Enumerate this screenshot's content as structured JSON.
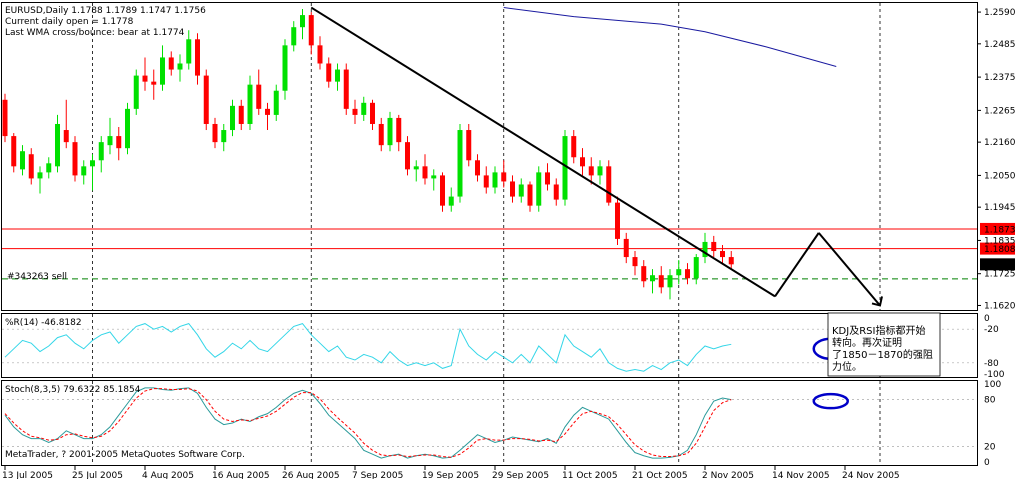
{
  "colors": {
    "background": "#ffffff",
    "bull": "#00e000",
    "bear": "#ff0000",
    "wma": "#1a1aa0",
    "trend": "#000000",
    "hline": "#ff0000",
    "sell_line": "#008000",
    "wpr": "#33d6e8",
    "stoch_main": "#2a9a9a",
    "stoch_signal": "#ff0000",
    "ellipse": "#0000c8"
  },
  "header": {
    "line1": "EURUSD,Daily  1.1788 1.1789 1.1747 1.1756",
    "line2": "Current daily open = 1.1778",
    "line3": "Last WMA cross/bounce: bear at 1.1774"
  },
  "order_label": "#343263 sell",
  "wpr_label": "%R(14) -46.8182",
  "stoch_label": "Stoch(8,3,5) 79.6322 85.1854",
  "copyright": "MetaTrader, ? 2001-2005 MetaQuotes Software Corp.",
  "annotation": [
    "KDJ及RSI指标都开始",
    "转向。再次证明",
    "了1850－1870的强阻",
    "力位。"
  ],
  "chart_data": {
    "type": "candlestick",
    "symbol": "EURUSD",
    "timeframe": "Daily",
    "price_ticks": [
      "1.2590",
      "1.2485",
      "1.2375",
      "1.2265",
      "1.2160",
      "1.2050",
      "1.1945",
      "1.1835",
      "1.1725",
      "1.1620"
    ],
    "price_range": [
      1.1605,
      1.262
    ],
    "x_labels": [
      "13 Jul 2005",
      "25 Jul 2005",
      "4 Aug 2005",
      "16 Aug 2005",
      "26 Aug 2005",
      "7 Sep 2005",
      "19 Sep 2005",
      "29 Sep 2005",
      "11 Oct 2005",
      "21 Oct 2005",
      "2 Nov 2005",
      "14 Nov 2005",
      "24 Nov 2005"
    ],
    "x_label_bars": [
      0,
      8,
      16,
      24,
      32,
      40,
      48,
      56,
      64,
      72,
      80,
      88,
      96
    ],
    "period_separator_bars": [
      10,
      35,
      57,
      77
    ],
    "future_separator_bar": 100,
    "price_levels": [
      {
        "value": 1.1873,
        "label": "1.1873",
        "style": "solid"
      },
      {
        "value": 1.1808,
        "label": "1.1808",
        "style": "solid"
      },
      {
        "value": 1.1756,
        "label": "1.1756",
        "style": "current"
      },
      {
        "value": 1.1708,
        "label": "",
        "style": "dashed"
      }
    ],
    "trend_lines": [
      {
        "from": [
          35,
          1.2605
        ],
        "to": [
          88,
          1.165
        ]
      },
      {
        "from": [
          88,
          1.165
        ],
        "to": [
          93,
          1.186
        ]
      },
      {
        "from": [
          93,
          1.186
        ],
        "to": [
          100,
          1.162
        ]
      }
    ],
    "wma": [
      {
        "bar": 57,
        "price": 1.2605
      },
      {
        "bar": 65,
        "price": 1.2575
      },
      {
        "bar": 75,
        "price": 1.255
      },
      {
        "bar": 80,
        "price": 1.2525
      },
      {
        "bar": 87,
        "price": 1.2475
      },
      {
        "bar": 95,
        "price": 1.241
      }
    ],
    "candles": [
      [
        1.23,
        1.232,
        1.216,
        1.218
      ],
      [
        1.218,
        1.219,
        1.206,
        1.208
      ],
      [
        1.207,
        1.215,
        1.205,
        1.213
      ],
      [
        1.212,
        1.214,
        1.202,
        1.204
      ],
      [
        1.204,
        1.208,
        1.199,
        1.206
      ],
      [
        1.206,
        1.211,
        1.204,
        1.209
      ],
      [
        1.208,
        1.225,
        1.206,
        1.222
      ],
      [
        1.22,
        1.23,
        1.214,
        1.216
      ],
      [
        1.216,
        1.218,
        1.203,
        1.205
      ],
      [
        1.205,
        1.21,
        1.202,
        1.208
      ],
      [
        1.208,
        1.212,
        1.2,
        1.21
      ],
      [
        1.21,
        1.218,
        1.206,
        1.216
      ],
      [
        1.215,
        1.224,
        1.212,
        1.218
      ],
      [
        1.218,
        1.221,
        1.21,
        1.214
      ],
      [
        1.214,
        1.229,
        1.212,
        1.227
      ],
      [
        1.227,
        1.24,
        1.225,
        1.238
      ],
      [
        1.238,
        1.244,
        1.233,
        1.236
      ],
      [
        1.236,
        1.24,
        1.23,
        1.235
      ],
      [
        1.235,
        1.248,
        1.233,
        1.244
      ],
      [
        1.244,
        1.246,
        1.238,
        1.24
      ],
      [
        1.24,
        1.245,
        1.236,
        1.242
      ],
      [
        1.242,
        1.253,
        1.24,
        1.25
      ],
      [
        1.25,
        1.252,
        1.235,
        1.238
      ],
      [
        1.238,
        1.24,
        1.22,
        1.222
      ],
      [
        1.222,
        1.224,
        1.214,
        1.216
      ],
      [
        1.216,
        1.222,
        1.213,
        1.22
      ],
      [
        1.22,
        1.23,
        1.218,
        1.228
      ],
      [
        1.228,
        1.23,
        1.22,
        1.222
      ],
      [
        1.222,
        1.238,
        1.22,
        1.235
      ],
      [
        1.235,
        1.24,
        1.225,
        1.227
      ],
      [
        1.227,
        1.229,
        1.22,
        1.225
      ],
      [
        1.225,
        1.235,
        1.223,
        1.233
      ],
      [
        1.233,
        1.25,
        1.23,
        1.248
      ],
      [
        1.248,
        1.256,
        1.246,
        1.254
      ],
      [
        1.254,
        1.26,
        1.25,
        1.258
      ],
      [
        1.258,
        1.259,
        1.245,
        1.248
      ],
      [
        1.248,
        1.251,
        1.24,
        1.242
      ],
      [
        1.242,
        1.244,
        1.234,
        1.236
      ],
      [
        1.236,
        1.242,
        1.233,
        1.24
      ],
      [
        1.24,
        1.242,
        1.225,
        1.227
      ],
      [
        1.227,
        1.23,
        1.222,
        1.225
      ],
      [
        1.225,
        1.231,
        1.223,
        1.229
      ],
      [
        1.229,
        1.23,
        1.22,
        1.222
      ],
      [
        1.222,
        1.224,
        1.213,
        1.215
      ],
      [
        1.215,
        1.226,
        1.213,
        1.224
      ],
      [
        1.224,
        1.225,
        1.213,
        1.216
      ],
      [
        1.216,
        1.218,
        1.205,
        1.207
      ],
      [
        1.207,
        1.21,
        1.203,
        1.208
      ],
      [
        1.208,
        1.212,
        1.202,
        1.204
      ],
      [
        1.204,
        1.207,
        1.2,
        1.205
      ],
      [
        1.205,
        1.206,
        1.193,
        1.195
      ],
      [
        1.195,
        1.201,
        1.193,
        1.198
      ],
      [
        1.198,
        1.222,
        1.196,
        1.22
      ],
      [
        1.22,
        1.222,
        1.208,
        1.21
      ],
      [
        1.21,
        1.212,
        1.203,
        1.205
      ],
      [
        1.205,
        1.208,
        1.199,
        1.201
      ],
      [
        1.201,
        1.208,
        1.199,
        1.206
      ],
      [
        1.206,
        1.21,
        1.201,
        1.203
      ],
      [
        1.203,
        1.205,
        1.196,
        1.198
      ],
      [
        1.198,
        1.204,
        1.196,
        1.202
      ],
      [
        1.202,
        1.203,
        1.193,
        1.195
      ],
      [
        1.195,
        1.208,
        1.193,
        1.206
      ],
      [
        1.206,
        1.209,
        1.2,
        1.202
      ],
      [
        1.202,
        1.204,
        1.195,
        1.197
      ],
      [
        1.197,
        1.22,
        1.195,
        1.218
      ],
      [
        1.218,
        1.22,
        1.209,
        1.211
      ],
      [
        1.211,
        1.214,
        1.205,
        1.208
      ],
      [
        1.208,
        1.211,
        1.202,
        1.205
      ],
      [
        1.205,
        1.21,
        1.202,
        1.208
      ],
      [
        1.208,
        1.21,
        1.195,
        1.196
      ],
      [
        1.196,
        1.198,
        1.182,
        1.184
      ],
      [
        1.184,
        1.186,
        1.176,
        1.178
      ],
      [
        1.178,
        1.18,
        1.172,
        1.175
      ],
      [
        1.175,
        1.177,
        1.168,
        1.17
      ],
      [
        1.17,
        1.174,
        1.166,
        1.172
      ],
      [
        1.172,
        1.175,
        1.166,
        1.168
      ],
      [
        1.168,
        1.174,
        1.164,
        1.172
      ],
      [
        1.172,
        1.177,
        1.169,
        1.174
      ],
      [
        1.174,
        1.176,
        1.169,
        1.171
      ],
      [
        1.171,
        1.179,
        1.169,
        1.178
      ],
      [
        1.178,
        1.186,
        1.176,
        1.183
      ],
      [
        1.183,
        1.185,
        1.178,
        1.18
      ],
      [
        1.18,
        1.182,
        1.176,
        1.178
      ],
      [
        1.178,
        1.18,
        1.174,
        1.1756
      ]
    ],
    "candle_start_bar": 0,
    "wpr": {
      "range": [
        -100,
        0
      ],
      "ticks": [
        "0",
        "-20",
        "-80",
        "-100"
      ],
      "levels": [
        -20,
        -80
      ],
      "values": [
        -70,
        -55,
        -40,
        -45,
        -60,
        -50,
        -35,
        -30,
        -45,
        -55,
        -40,
        -30,
        -25,
        -45,
        -30,
        -15,
        -10,
        -20,
        -15,
        -25,
        -15,
        -10,
        -30,
        -55,
        -70,
        -60,
        -45,
        -55,
        -40,
        -55,
        -60,
        -45,
        -30,
        -15,
        -10,
        -30,
        -45,
        -60,
        -50,
        -70,
        -75,
        -65,
        -70,
        -80,
        -60,
        -75,
        -85,
        -80,
        -85,
        -80,
        -90,
        -85,
        -20,
        -50,
        -65,
        -75,
        -60,
        -70,
        -80,
        -65,
        -80,
        -50,
        -65,
        -80,
        -30,
        -50,
        -60,
        -70,
        -55,
        -80,
        -90,
        -95,
        -92,
        -95,
        -85,
        -92,
        -80,
        -75,
        -85,
        -65,
        -50,
        -55,
        -50,
        -47
      ]
    },
    "stoch": {
      "range": [
        0,
        100
      ],
      "ticks": [
        "100",
        "80",
        "20",
        "0"
      ],
      "levels": [
        80,
        20
      ],
      "main": [
        60,
        45,
        35,
        30,
        30,
        25,
        30,
        40,
        35,
        30,
        30,
        35,
        45,
        60,
        75,
        90,
        95,
        95,
        93,
        92,
        94,
        95,
        88,
        70,
        55,
        48,
        50,
        55,
        52,
        58,
        62,
        70,
        80,
        88,
        92,
        88,
        75,
        60,
        50,
        40,
        30,
        15,
        10,
        5,
        8,
        10,
        5,
        8,
        10,
        8,
        5,
        6,
        15,
        25,
        35,
        30,
        25,
        28,
        32,
        30,
        28,
        26,
        30,
        24,
        45,
        60,
        70,
        65,
        60,
        55,
        40,
        25,
        12,
        8,
        5,
        5,
        6,
        8,
        15,
        35,
        60,
        78,
        82,
        80
      ],
      "signal": [
        62,
        50,
        40,
        33,
        31,
        28,
        29,
        35,
        36,
        33,
        31,
        33,
        40,
        52,
        67,
        82,
        91,
        94,
        94,
        93,
        93,
        94,
        91,
        80,
        65,
        55,
        52,
        54,
        53,
        56,
        59,
        65,
        74,
        83,
        89,
        89,
        81,
        68,
        57,
        47,
        37,
        24,
        15,
        9,
        8,
        9,
        7,
        8,
        9,
        9,
        7,
        6,
        10,
        18,
        28,
        30,
        28,
        28,
        30,
        30,
        29,
        27,
        28,
        26,
        36,
        50,
        62,
        65,
        62,
        58,
        48,
        35,
        22,
        14,
        9,
        7,
        7,
        8,
        11,
        24,
        45,
        66,
        76,
        80
      ]
    },
    "ellipses": [
      {
        "panel": "wpr",
        "bar": 93,
        "value": -55
      },
      {
        "panel": "stoch",
        "bar": 93,
        "value": 78
      }
    ]
  }
}
